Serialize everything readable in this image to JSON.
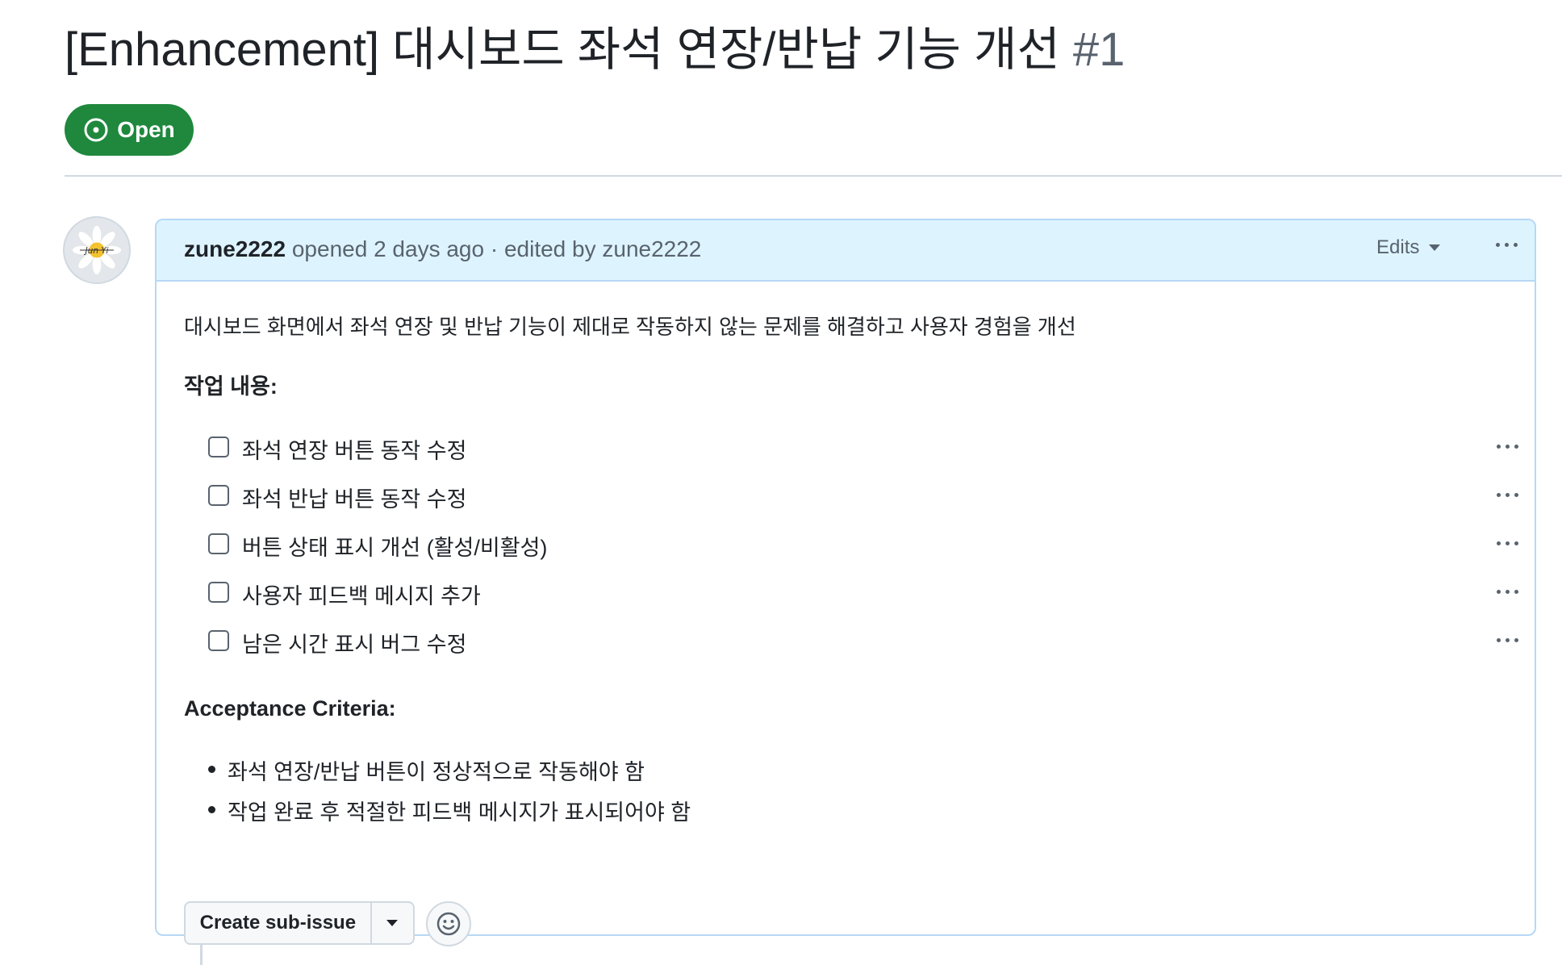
{
  "issue": {
    "title": "[Enhancement] 대시보드 좌석 연장/반납 기능 개선",
    "number": "#1",
    "state": "Open"
  },
  "comment": {
    "author": "zune2222",
    "opened_text": "opened 2 days ago · edited by zune2222",
    "edits_label": "Edits",
    "avatar_text": "Jun Yi",
    "description": "대시보드 화면에서 좌석 연장 및 반납 기능이 제대로 작동하지 않는 문제를 해결하고 사용자 경험을 개선",
    "tasks_heading": "작업 내용:",
    "tasks": [
      {
        "label": "좌석 연장 버튼 동작 수정",
        "checked": false
      },
      {
        "label": "좌석 반납 버튼 동작 수정",
        "checked": false
      },
      {
        "label": "버튼 상태 표시 개선 (활성/비활성)",
        "checked": false
      },
      {
        "label": "사용자 피드백 메시지 추가",
        "checked": false
      },
      {
        "label": "남은 시간 표시 버그 수정",
        "checked": false
      }
    ],
    "criteria_heading": "Acceptance Criteria:",
    "criteria": [
      "좌석 연장/반납 버튼이 정상적으로 작동해야 함",
      "작업 완료 후 적절한 피드백 메시지가 표시되어야 함"
    ],
    "create_subissue_label": "Create sub-issue"
  },
  "colors": {
    "open_green": "#1f883d",
    "header_blue": "#ddf4ff",
    "border_blue": "#b6d8f5"
  }
}
